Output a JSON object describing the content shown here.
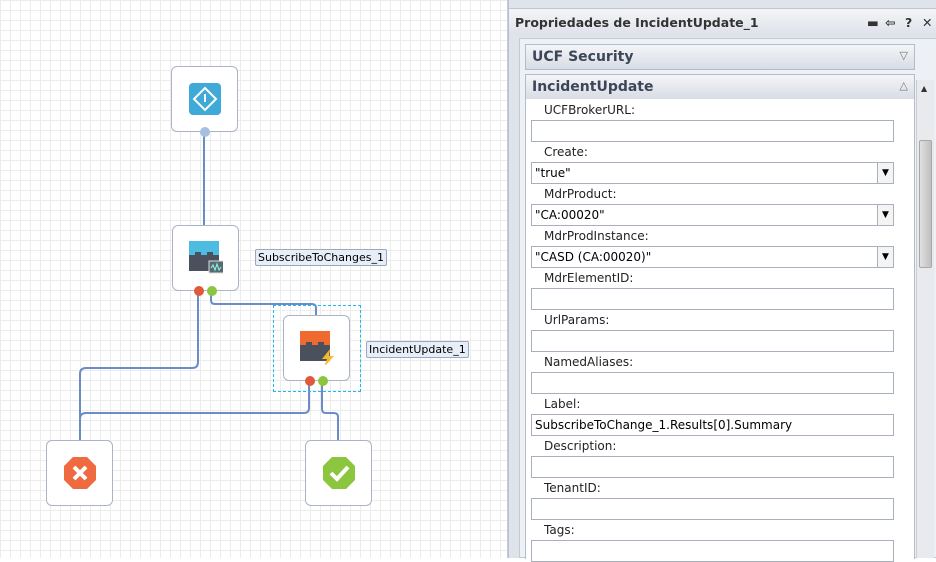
{
  "canvas": {
    "nodes": [
      {
        "name": "start",
        "icon": "start-diamond-icon"
      },
      {
        "name": "SubscribeToChanges_1",
        "label": "SubscribeToChanges_1",
        "icon": "subscribe-operator-icon"
      },
      {
        "name": "IncidentUpdate_1",
        "label": "IncidentUpdate_1",
        "icon": "update-operator-icon",
        "selected": true
      },
      {
        "name": "stop-failure",
        "icon": "failure-x-icon"
      },
      {
        "name": "stop-success",
        "icon": "success-check-icon"
      }
    ],
    "colors": {
      "wire": "#6c8cc8",
      "selection": "#22b8ee",
      "fail": "#e05a3a",
      "success": "#8cc63e"
    }
  },
  "panel": {
    "title": "Propriedades de IncidentUpdate_1",
    "sections": [
      {
        "label": "UCF Security",
        "expanded": false
      },
      {
        "label": "IncidentUpdate",
        "expanded": true
      }
    ],
    "fields": [
      {
        "label": "UCFBrokerURL:",
        "value": "",
        "type": "text"
      },
      {
        "label": "Create:",
        "value": "\"true\"",
        "type": "select"
      },
      {
        "label": "MdrProduct:",
        "value": "\"CA:00020\"",
        "type": "select"
      },
      {
        "label": "MdrProdInstance:",
        "value": "\"CASD (CA:00020)\"",
        "type": "select"
      },
      {
        "label": "MdrElementID:",
        "value": "",
        "type": "text"
      },
      {
        "label": "UrlParams:",
        "value": "",
        "type": "text"
      },
      {
        "label": "NamedAliases:",
        "value": "",
        "type": "text"
      },
      {
        "label": "Label:",
        "value": "SubscribeToChange_1.Results[0].Summary",
        "type": "text"
      },
      {
        "label": "Description:",
        "value": "",
        "type": "text"
      },
      {
        "label": "TenantID:",
        "value": "",
        "type": "text"
      },
      {
        "label": "Tags:",
        "value": "",
        "type": "text"
      }
    ]
  }
}
